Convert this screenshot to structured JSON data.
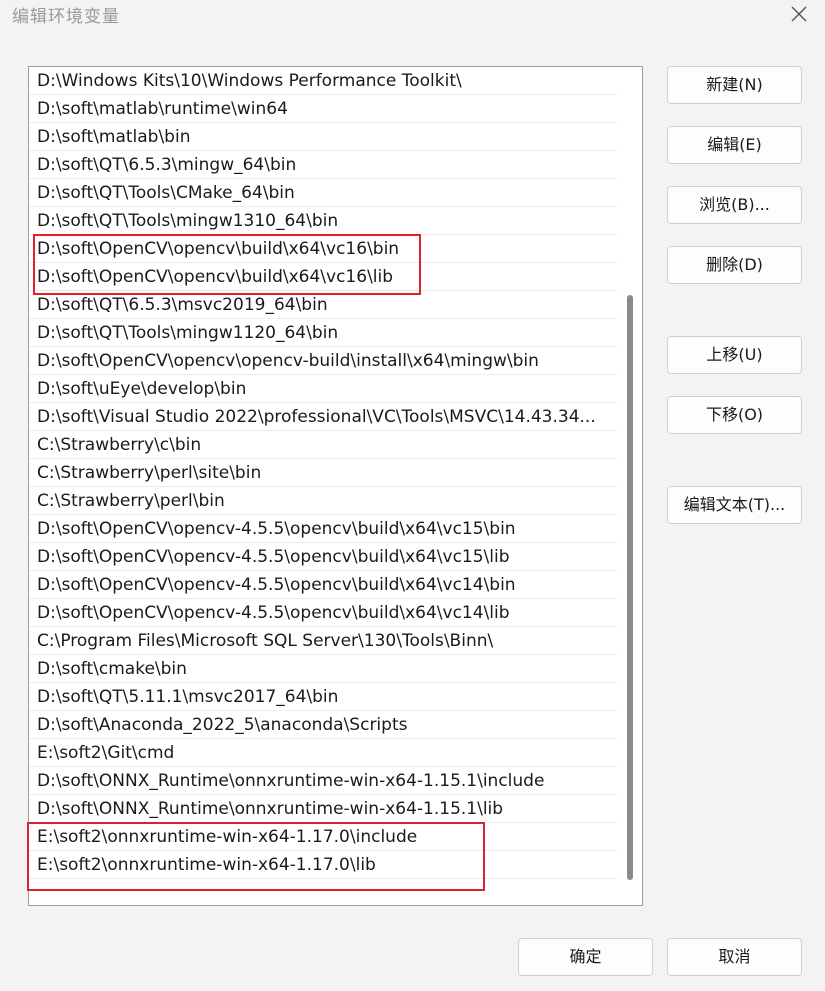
{
  "window": {
    "title": "编辑环境变量",
    "close_glyph": "×"
  },
  "path_list": {
    "items": [
      "D:\\Windows Kits\\10\\Windows Performance Toolkit\\",
      "D:\\soft\\matlab\\runtime\\win64",
      "D:\\soft\\matlab\\bin",
      "D:\\soft\\QT\\6.5.3\\mingw_64\\bin",
      "D:\\soft\\QT\\Tools\\CMake_64\\bin",
      "D:\\soft\\QT\\Tools\\mingw1310_64\\bin",
      "D:\\soft\\OpenCV\\opencv\\build\\x64\\vc16\\bin",
      "D:\\soft\\OpenCV\\opencv\\build\\x64\\vc16\\lib",
      "D:\\soft\\QT\\6.5.3\\msvc2019_64\\bin",
      "D:\\soft\\QT\\Tools\\mingw1120_64\\bin",
      "D:\\soft\\OpenCV\\opencv\\opencv-build\\install\\x64\\mingw\\bin",
      "D:\\soft\\uEye\\develop\\bin",
      "D:\\soft\\Visual Studio 2022\\professional\\VC\\Tools\\MSVC\\14.43.34...",
      "C:\\Strawberry\\c\\bin",
      "C:\\Strawberry\\perl\\site\\bin",
      "C:\\Strawberry\\perl\\bin",
      "D:\\soft\\OpenCV\\opencv-4.5.5\\opencv\\build\\x64\\vc15\\bin",
      "D:\\soft\\OpenCV\\opencv-4.5.5\\opencv\\build\\x64\\vc15\\lib",
      "D:\\soft\\OpenCV\\opencv-4.5.5\\opencv\\build\\x64\\vc14\\bin",
      "D:\\soft\\OpenCV\\opencv-4.5.5\\opencv\\build\\x64\\vc14\\lib",
      "C:\\Program Files\\Microsoft SQL Server\\130\\Tools\\Binn\\",
      "D:\\soft\\cmake\\bin",
      "D:\\soft\\QT\\5.11.1\\msvc2017_64\\bin",
      "D:\\soft\\Anaconda_2022_5\\anaconda\\Scripts",
      "E:\\soft2\\Git\\cmd",
      "D:\\soft\\ONNX_Runtime\\onnxruntime-win-x64-1.15.1\\include",
      "D:\\soft\\ONNX_Runtime\\onnxruntime-win-x64-1.15.1\\lib",
      "E:\\soft2\\onnxruntime-win-x64-1.17.0\\include",
      "E:\\soft2\\onnxruntime-win-x64-1.17.0\\lib"
    ]
  },
  "buttons": {
    "new": "新建(N)",
    "edit": "编辑(E)",
    "browse": "浏览(B)...",
    "delete": "删除(D)",
    "move_up": "上移(U)",
    "move_down": "下移(O)",
    "edit_text": "编辑文本(T)...",
    "ok": "确定",
    "cancel": "取消"
  },
  "colors": {
    "highlight_border": "#e0202a",
    "background": "#f3f3f3"
  }
}
